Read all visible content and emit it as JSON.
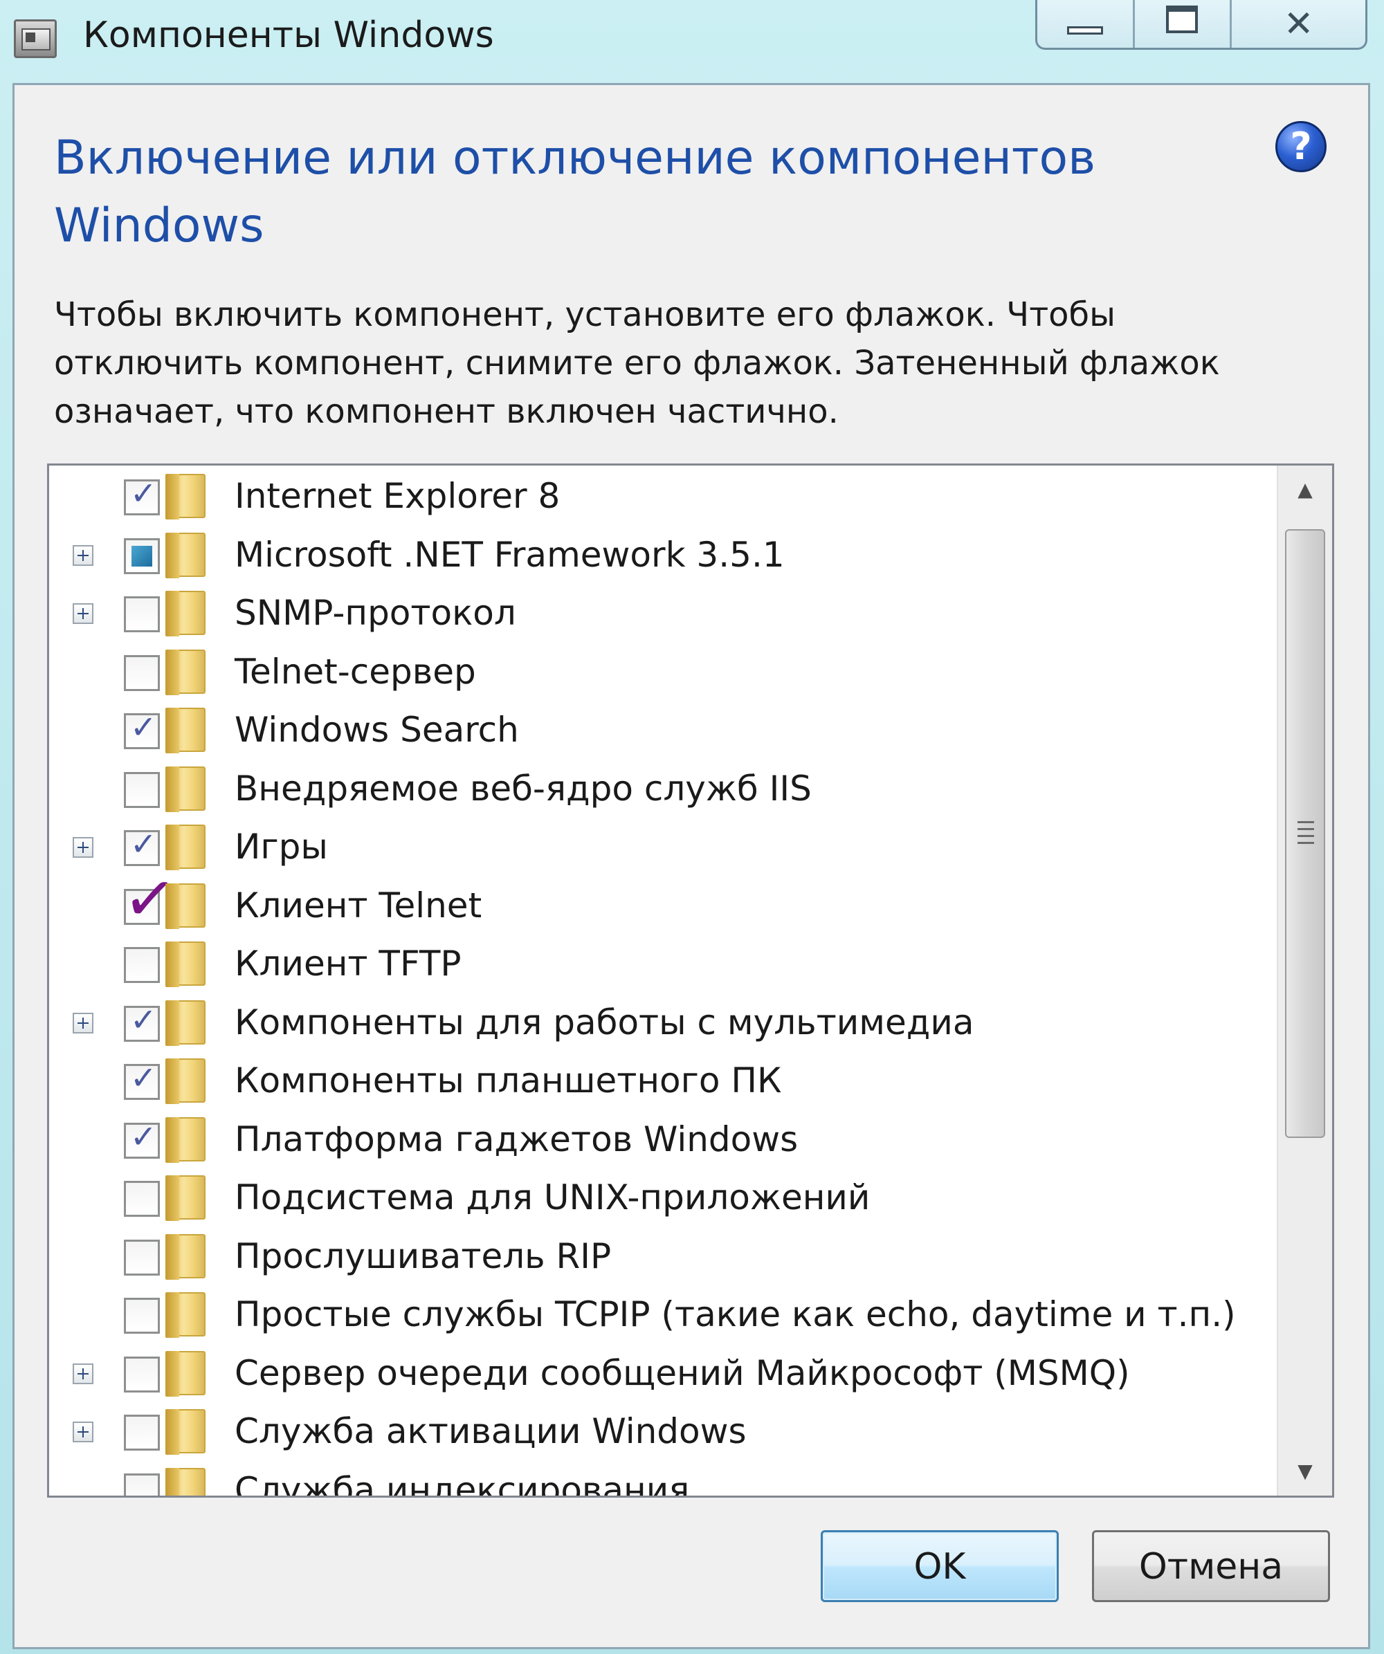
{
  "window": {
    "title": "Компоненты Windows",
    "controls": {
      "minimize": "minimize-icon",
      "maximize": "maximize-icon",
      "close": "close-icon"
    }
  },
  "heading": "Включение или отключение компонентов Windows",
  "description": "Чтобы включить компонент, установите его флажок. Чтобы отключить компонент, снимите его флажок. Затененный флажок означает, что компонент включен частично.",
  "features": [
    {
      "label": "Internet Explorer 8",
      "state": "checked",
      "expandable": false
    },
    {
      "label": "Microsoft .NET Framework 3.5.1",
      "state": "partial",
      "expandable": true
    },
    {
      "label": "SNMP-протокол",
      "state": "unchecked",
      "expandable": true
    },
    {
      "label": "Telnet-сервер",
      "state": "unchecked",
      "expandable": false
    },
    {
      "label": "Windows Search",
      "state": "checked",
      "expandable": false
    },
    {
      "label": "Внедряемое веб-ядро служб IIS",
      "state": "unchecked",
      "expandable": false
    },
    {
      "label": "Игры",
      "state": "checked",
      "expandable": true
    },
    {
      "label": "Клиент Telnet",
      "state": "checked-annotated",
      "expandable": false
    },
    {
      "label": "Клиент TFTP",
      "state": "unchecked",
      "expandable": false
    },
    {
      "label": "Компоненты для работы с мультимедиа",
      "state": "checked",
      "expandable": true
    },
    {
      "label": "Компоненты планшетного ПК",
      "state": "checked",
      "expandable": false
    },
    {
      "label": "Платформа гаджетов Windows",
      "state": "checked",
      "expandable": false
    },
    {
      "label": "Подсистема для UNIX-приложений",
      "state": "unchecked",
      "expandable": false
    },
    {
      "label": "Прослушиватель RIP",
      "state": "unchecked",
      "expandable": false
    },
    {
      "label": "Простые службы TCPIP (такие как echo, daytime и т.п.)",
      "state": "unchecked",
      "expandable": false
    },
    {
      "label": "Сервер очереди сообщений Майкрософт (MSMQ)",
      "state": "unchecked",
      "expandable": true
    },
    {
      "label": "Служба активации Windows",
      "state": "unchecked",
      "expandable": true
    },
    {
      "label": "Служба индексирования",
      "state": "unchecked",
      "expandable": false
    }
  ],
  "buttons": {
    "ok": "OK",
    "cancel": "Отмена"
  },
  "colors": {
    "heading": "#1e4fa8",
    "annotation_check": "#7a1487"
  }
}
